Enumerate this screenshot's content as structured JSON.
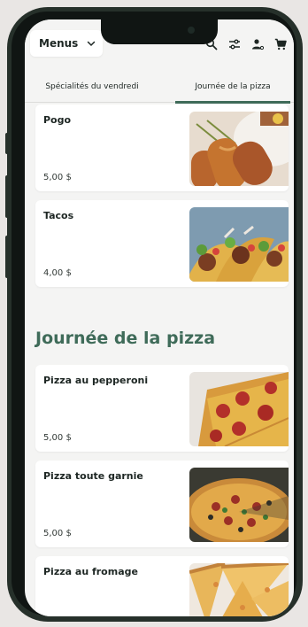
{
  "header": {
    "menu_label": "Menus",
    "icons": [
      "search-icon",
      "filter-icon",
      "user-icon",
      "cart-icon"
    ]
  },
  "tabs": [
    {
      "label": "Spécialités du vendredi",
      "active": false
    },
    {
      "label": "Journée de la pizza",
      "active": true
    }
  ],
  "friday_items": [
    {
      "name": "Pogo",
      "price": "5,00 $",
      "image": "corn-dog-image"
    },
    {
      "name": "Tacos",
      "price": "4,00 $",
      "image": "tacos-image"
    }
  ],
  "pizza_section": {
    "title": "Journée de la pizza",
    "items": [
      {
        "name": "Pizza au pepperoni",
        "price": "5,00 $",
        "image": "pepperoni-pizza-image"
      },
      {
        "name": "Pizza toute garnie",
        "price": "5,00 $",
        "image": "all-dressed-pizza-image"
      },
      {
        "name": "Pizza au fromage",
        "price": "",
        "image": "cheese-pizza-image"
      }
    ]
  },
  "colors": {
    "accent": "#3f6b59",
    "background": "#f4f4f3",
    "frame": "#26302a"
  }
}
